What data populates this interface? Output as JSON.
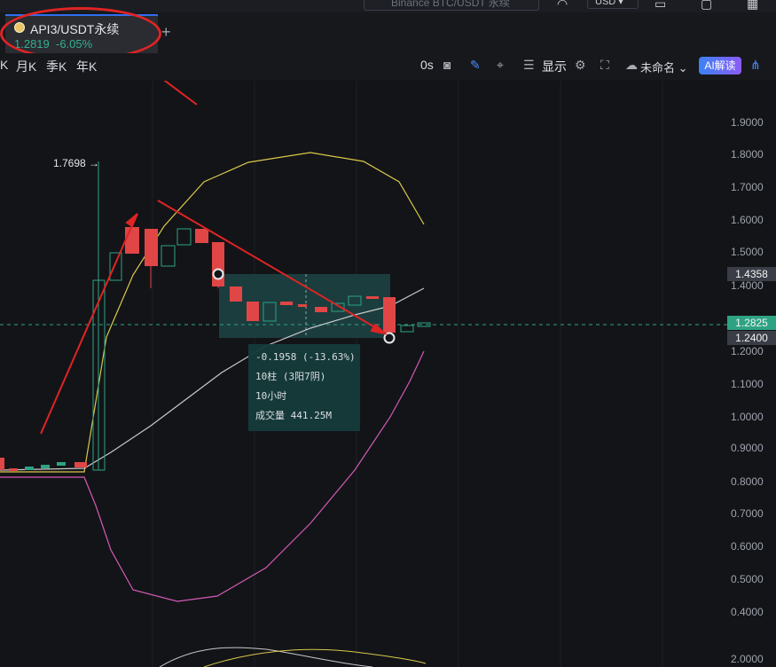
{
  "header": {
    "search_placeholder": "Binance BTC/USDT 永续",
    "currency": "USD"
  },
  "tab": {
    "symbol": "API3/USDT永续",
    "price": "1.2819",
    "change": "-6.05%",
    "add_label": "+"
  },
  "toolbar": {
    "timeframes": [
      "K",
      "月K",
      "季K",
      "年K"
    ],
    "countdown": "0s",
    "display_label": "显示",
    "layout_name": "未命名",
    "ai_label": "AI解读"
  },
  "price_axis": {
    "ticks": [
      "1.9000",
      "1.8000",
      "1.7000",
      "1.6000",
      "1.5000",
      "1.4000",
      "1.2000",
      "1.1000",
      "1.0000",
      "0.9000",
      "0.8000",
      "0.7000",
      "0.6000",
      "0.5000",
      "0.4000"
    ],
    "sub_tick": "2.0000",
    "tag_high": "1.4358",
    "tag_current": "1.2825",
    "tag_low": "1.2400"
  },
  "chart": {
    "high_marker": "1.7698",
    "colors": {
      "up": "#2ea383",
      "down": "#e04646",
      "upper_band": "#d9c84a",
      "lower_band": "#d45ab3",
      "mid_band": "#c8c8c8",
      "annotation": "#e02424"
    }
  },
  "measure_tooltip": {
    "change": "-0.1958 (-13.63%)",
    "bars": "10柱 (3阳7阴)",
    "duration": "10小时",
    "volume": "成交量 441.25M"
  }
}
